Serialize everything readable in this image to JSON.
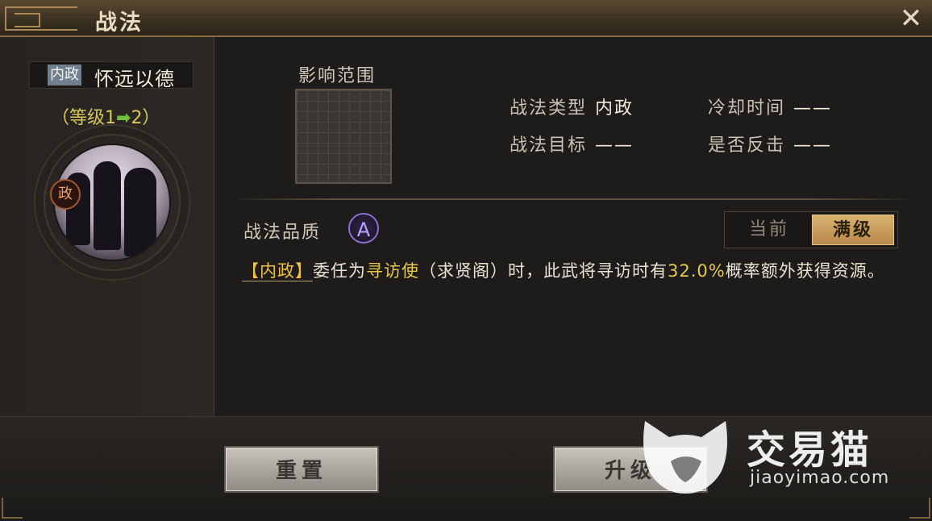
{
  "window": {
    "title": "战法",
    "close_icon": "close-icon"
  },
  "sidebar": {
    "type_badge": "内政",
    "skill_name": "怀远以德",
    "level_prefix": "（等级1",
    "level_arrow": "➡",
    "level_suffix": "2）",
    "portrait_badge": "政"
  },
  "main": {
    "range_label": "影响范围",
    "info": {
      "type_label": "战法类型",
      "type_value": "内政",
      "cooldown_label": "冷却时间",
      "cooldown_value": "——",
      "target_label": "战法目标",
      "target_value": "——",
      "counter_label": "是否反击",
      "counter_value": "——"
    },
    "quality_label": "战法品质",
    "quality_value": "A",
    "toggle": {
      "current": "当前",
      "max": "满级",
      "selected": "满级"
    },
    "description": {
      "tag": "【内政】",
      "part1": "委任为",
      "hl1": "寻访使",
      "part2": "（求贤阁）时，此武将寻访时有",
      "hl2": "32.0%",
      "part3": "概率额外获得资源。"
    }
  },
  "footer": {
    "reset_label": "重置",
    "upgrade_label": "升级"
  },
  "watermark": {
    "text": "交易猫",
    "url": "jiaoyimao.com"
  },
  "colors": {
    "accent_gold": "#d9b270",
    "highlight_yellow": "#e9c84a",
    "quality_purple": "#8a70d0",
    "arrow_green": "#6fbf3d"
  }
}
